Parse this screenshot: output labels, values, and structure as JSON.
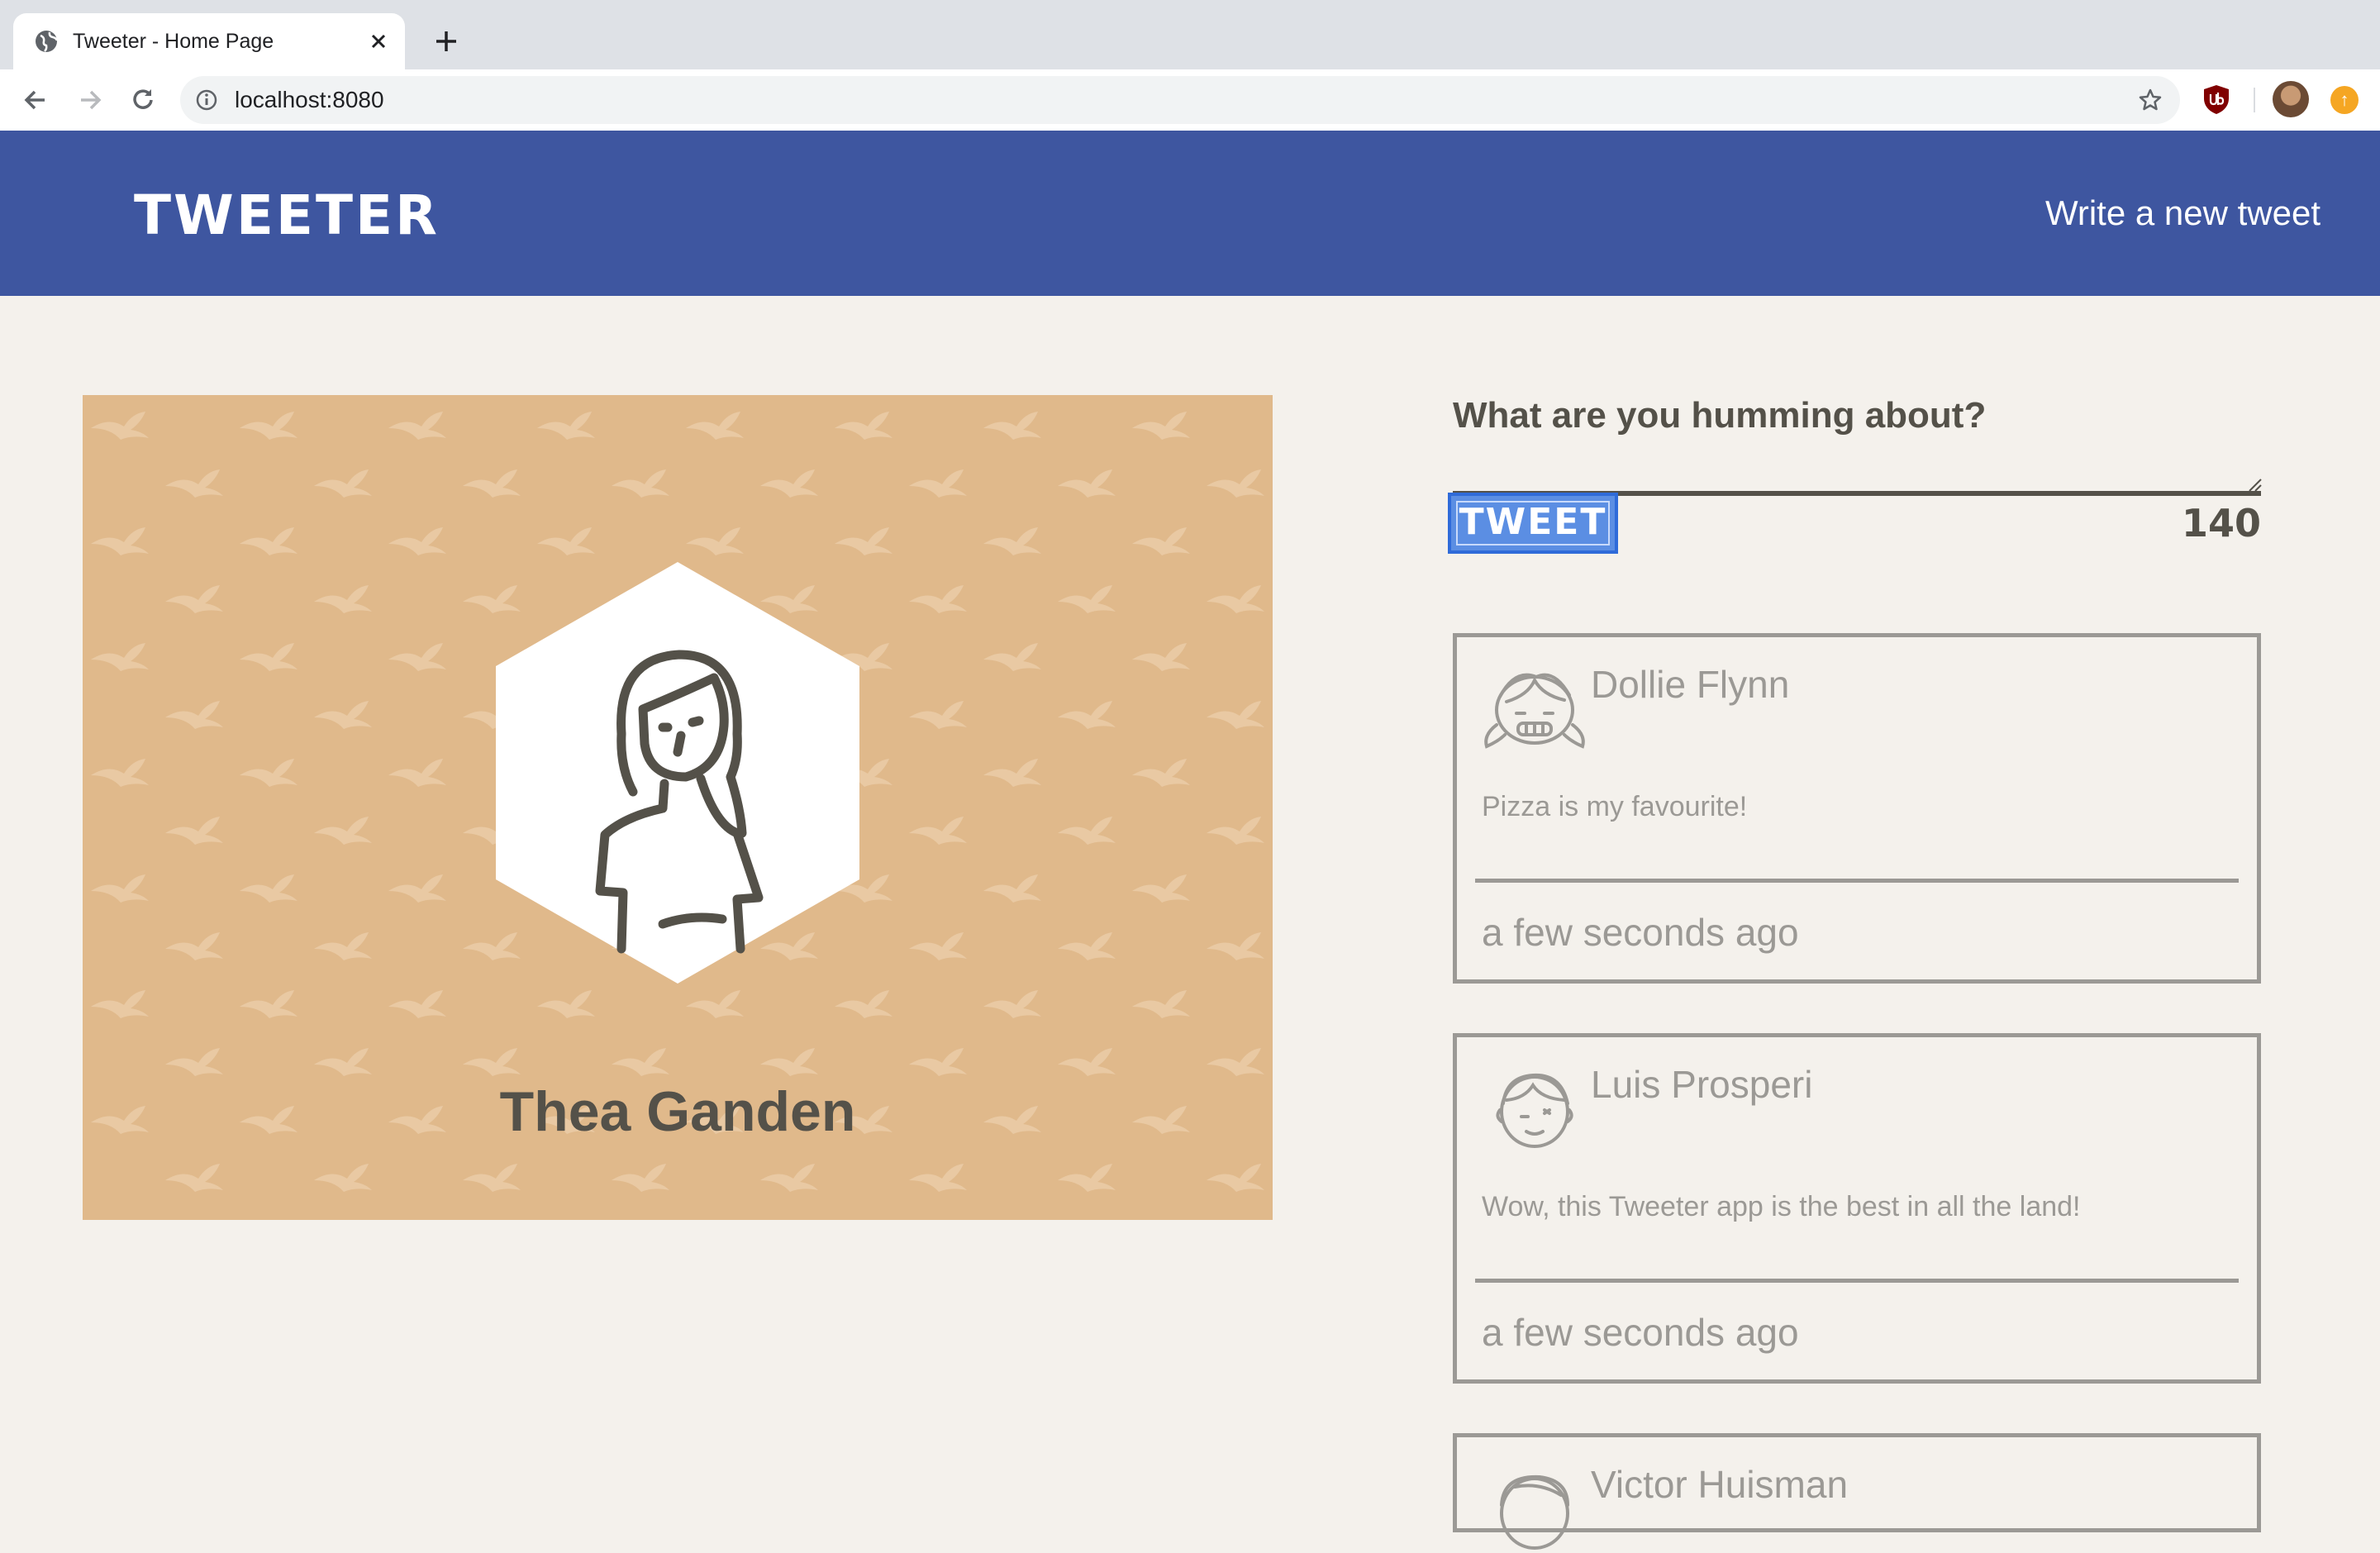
{
  "browser": {
    "tab_title": "Tweeter - Home Page",
    "url": "localhost:8080",
    "icons": [
      "globe-icon",
      "close-icon",
      "plus-icon",
      "back-icon",
      "forward-icon",
      "reload-icon",
      "info-icon",
      "star-icon",
      "ublock-icon",
      "profile-avatar",
      "extension-icon"
    ]
  },
  "header": {
    "brand": "Tweeter",
    "compose_link": "Write a new tweet",
    "background": "#3e56a0"
  },
  "profile": {
    "name": "Thea Ganden",
    "card_color": "#e0b98b"
  },
  "compose": {
    "heading": "What are you humming about?",
    "textarea_value": "",
    "button_label": "Tweet",
    "counter": "140"
  },
  "tweets": [
    {
      "author": "Dollie Flynn",
      "text": "Pizza is my favourite!",
      "time": "a few seconds ago"
    },
    {
      "author": "Luis Prosperi",
      "text": "Wow, this Tweeter app is the best in all the land!",
      "time": "a few seconds ago"
    },
    {
      "author": "Victor Huisman",
      "text": "",
      "time": ""
    }
  ]
}
